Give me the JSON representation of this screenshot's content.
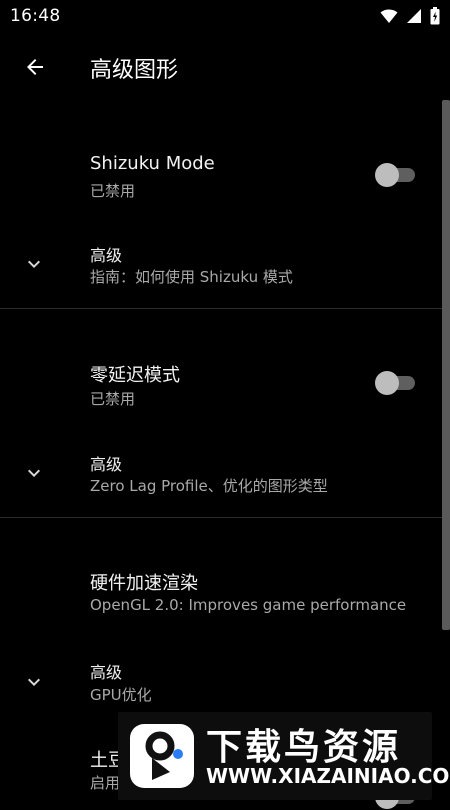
{
  "status_bar": {
    "time": "16:48",
    "icons": [
      "wifi-icon",
      "signal-icon",
      "battery-icon"
    ]
  },
  "app_bar": {
    "title": "高级图形",
    "back_icon": "arrow-back-icon"
  },
  "sections": [
    {
      "title": "Shizuku Mode",
      "status": "已禁用",
      "toggle_on": false,
      "advanced_label": "高级",
      "advanced_sub": "指南：如何使用 Shizuku 模式"
    },
    {
      "title": "零延迟模式",
      "status": "已禁用",
      "toggle_on": false,
      "advanced_label": "高级",
      "advanced_sub": "Zero Lag Profile、优化的图形类型"
    },
    {
      "title": "硬件加速渲染",
      "status": "OpenGL 2.0: Improves game performance",
      "advanced_label": "高级",
      "advanced_sub": "GPU优化"
    },
    {
      "title": "土豆",
      "status": "启用"
    }
  ],
  "watermark": {
    "title": "下载鸟资源",
    "url": "WWW.XIAZAINIAO.COM"
  },
  "colors": {
    "background": "#000000",
    "text_primary": "#ffffff",
    "text_secondary": "#a9a9a9",
    "toggle_track_off": "#5f5f5f",
    "toggle_thumb_off": "#bdbdbd",
    "divider": "#2c2c2c"
  }
}
